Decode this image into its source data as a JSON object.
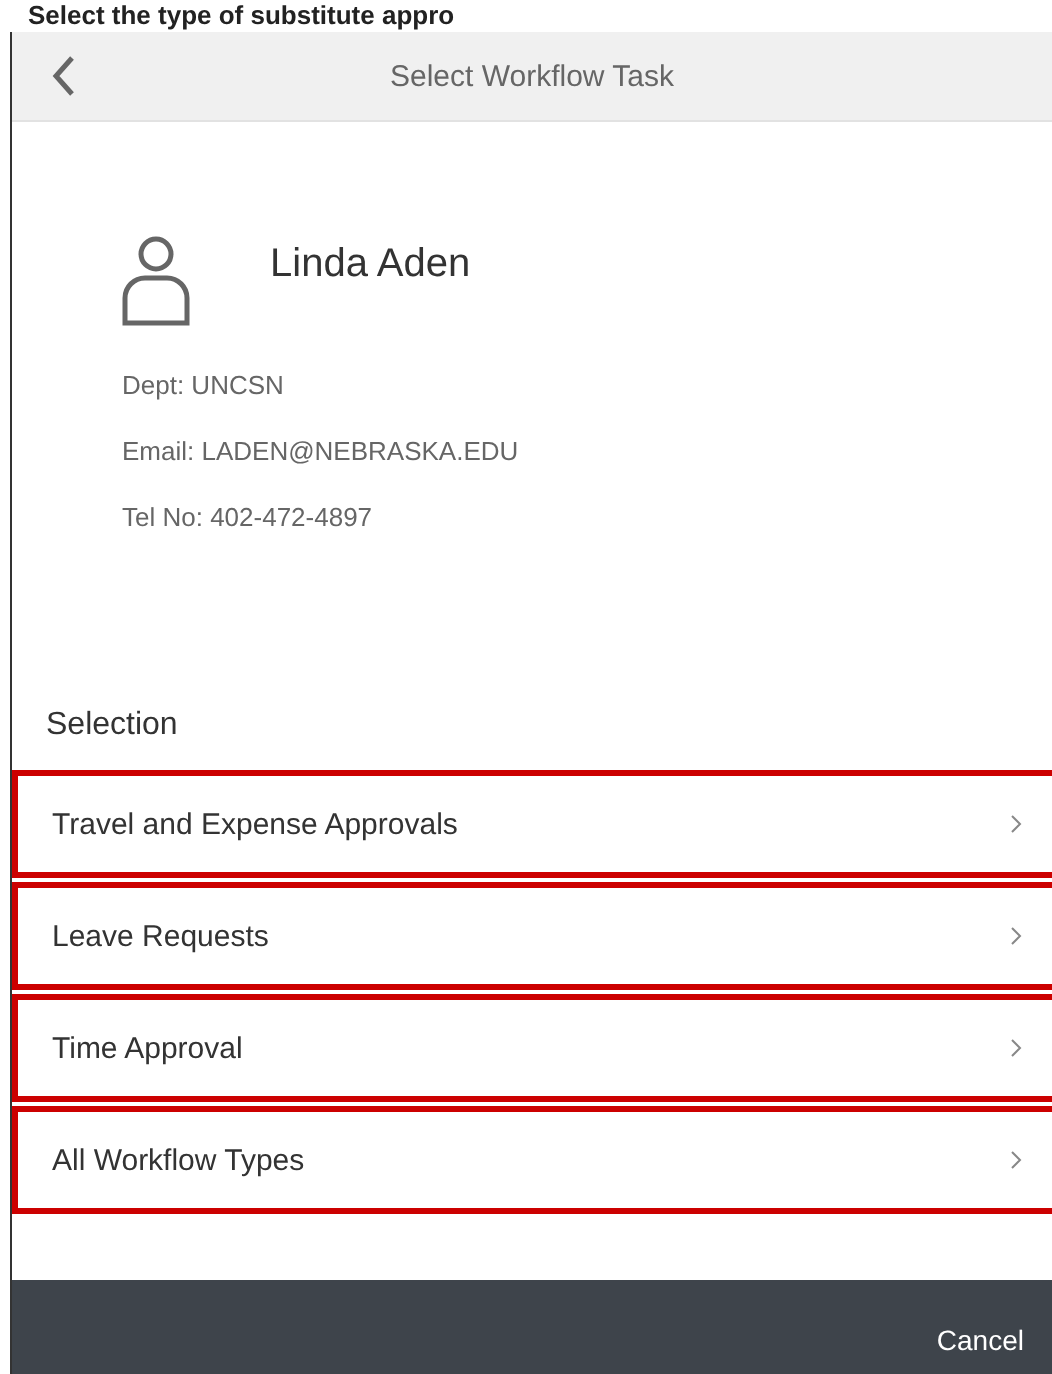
{
  "instruction_heading": "Select the type of substitute appro",
  "header": {
    "title": "Select Workflow Task"
  },
  "user": {
    "name": "Linda Aden",
    "details": [
      "Dept: UNCSN",
      "Email: LADEN@NEBRASKA.EDU",
      "Tel No: 402-472-4897"
    ]
  },
  "selection": {
    "title": "Selection",
    "items": [
      {
        "label": "Travel and Expense Approvals",
        "highlighted": true
      },
      {
        "label": "Leave Requests",
        "highlighted": true
      },
      {
        "label": "Time Approval",
        "highlighted": true
      },
      {
        "label": "All Workflow Types",
        "highlighted": true
      }
    ]
  },
  "footer": {
    "cancel": "Cancel"
  }
}
